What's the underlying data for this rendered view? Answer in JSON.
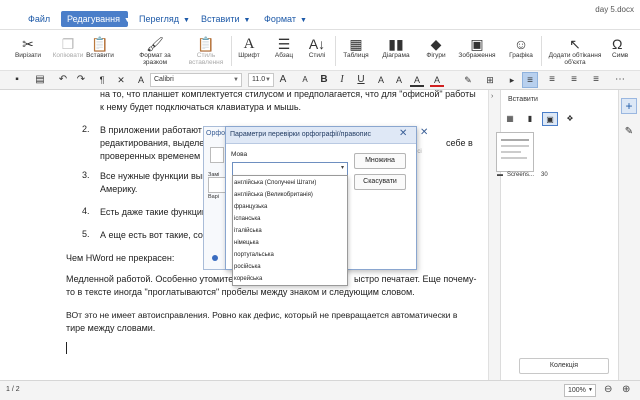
{
  "menu": {
    "file": "Файл",
    "edit": "Редагування",
    "view": "Перегляд",
    "insert": "Вставити",
    "format": "Формат",
    "doc_title": "day 5.docx"
  },
  "ribbon": {
    "cut": "Вирізати",
    "copy": "Копіювати",
    "paste": "Вставити",
    "paste_format": "Формат за зразком",
    "paste_style": "Стиль вставлення",
    "font": "Шрифт",
    "paragraph": "Абзац",
    "styles": "Стилі",
    "table": "Таблиця",
    "chart": "Діаграма",
    "shapes": "Фігури",
    "image": "Зображення",
    "graphics": "Графіка",
    "wrap": "Додати обтікання об'єкта",
    "symbol": "Симв"
  },
  "format_bar": {
    "font_name": "Calibri",
    "font_size": "11.0"
  },
  "document": {
    "line0": "на то, что планшет комплектуется стилусом и предполагается, что для \"офисной\" работы",
    "line1": "к нему будет подключаться клавиатура и мышь.",
    "item2_num": "2.",
    "item2_a": "В приложении работают",
    "item2_b": "редактирования, выделе",
    "item2_b_tail": "себе в",
    "item2_c": "проверенных временем в",
    "item3_num": "3.",
    "item3_a": "Все нужные функции вын",
    "item3_b": "Америку.",
    "item4_num": "4.",
    "item4": "Есть даже такие функции",
    "item5_num": "5.",
    "item5": "А еще есть вот такие, сово",
    "p1": "Чем HWord не прекрасен:",
    "p2a": "Медленной работой. Особенно утомите",
    "p2a_tail": "ыстро печатает. Еще почему-",
    "p2b": "то в тексте иногда \"проглатываются\" пробелы между знаком и следующим словом.",
    "p3a": "ВОт это не имеет автоисправления. Ровно как дефис, который не превращается автоматически в",
    "p3b": "тире между словами."
  },
  "side_panel": {
    "title": "Вставити",
    "thumb_label": "Screens...",
    "thumb_count": "30",
    "collection_button": "Колекція"
  },
  "status": {
    "page": "1 / 2",
    "zoom": "100%"
  },
  "back_dialog": {
    "title_fragment": "Орфо",
    "lbl_zam": "Замі",
    "lbl_var": "Варі",
    "btn_frag": "ісі"
  },
  "dialog": {
    "title": "Параметри перевірки орфографії/правопис",
    "language_label": "Мова",
    "language_value": "",
    "btn_multiple": "Множина",
    "btn_cancel": "Скасувати",
    "options": [
      "англійська (Сполучені Штати)",
      "англійська (Великобританія)",
      "французька",
      "іспанська",
      "італійська",
      "німецька",
      "португальська",
      "російська",
      "корейська"
    ]
  }
}
